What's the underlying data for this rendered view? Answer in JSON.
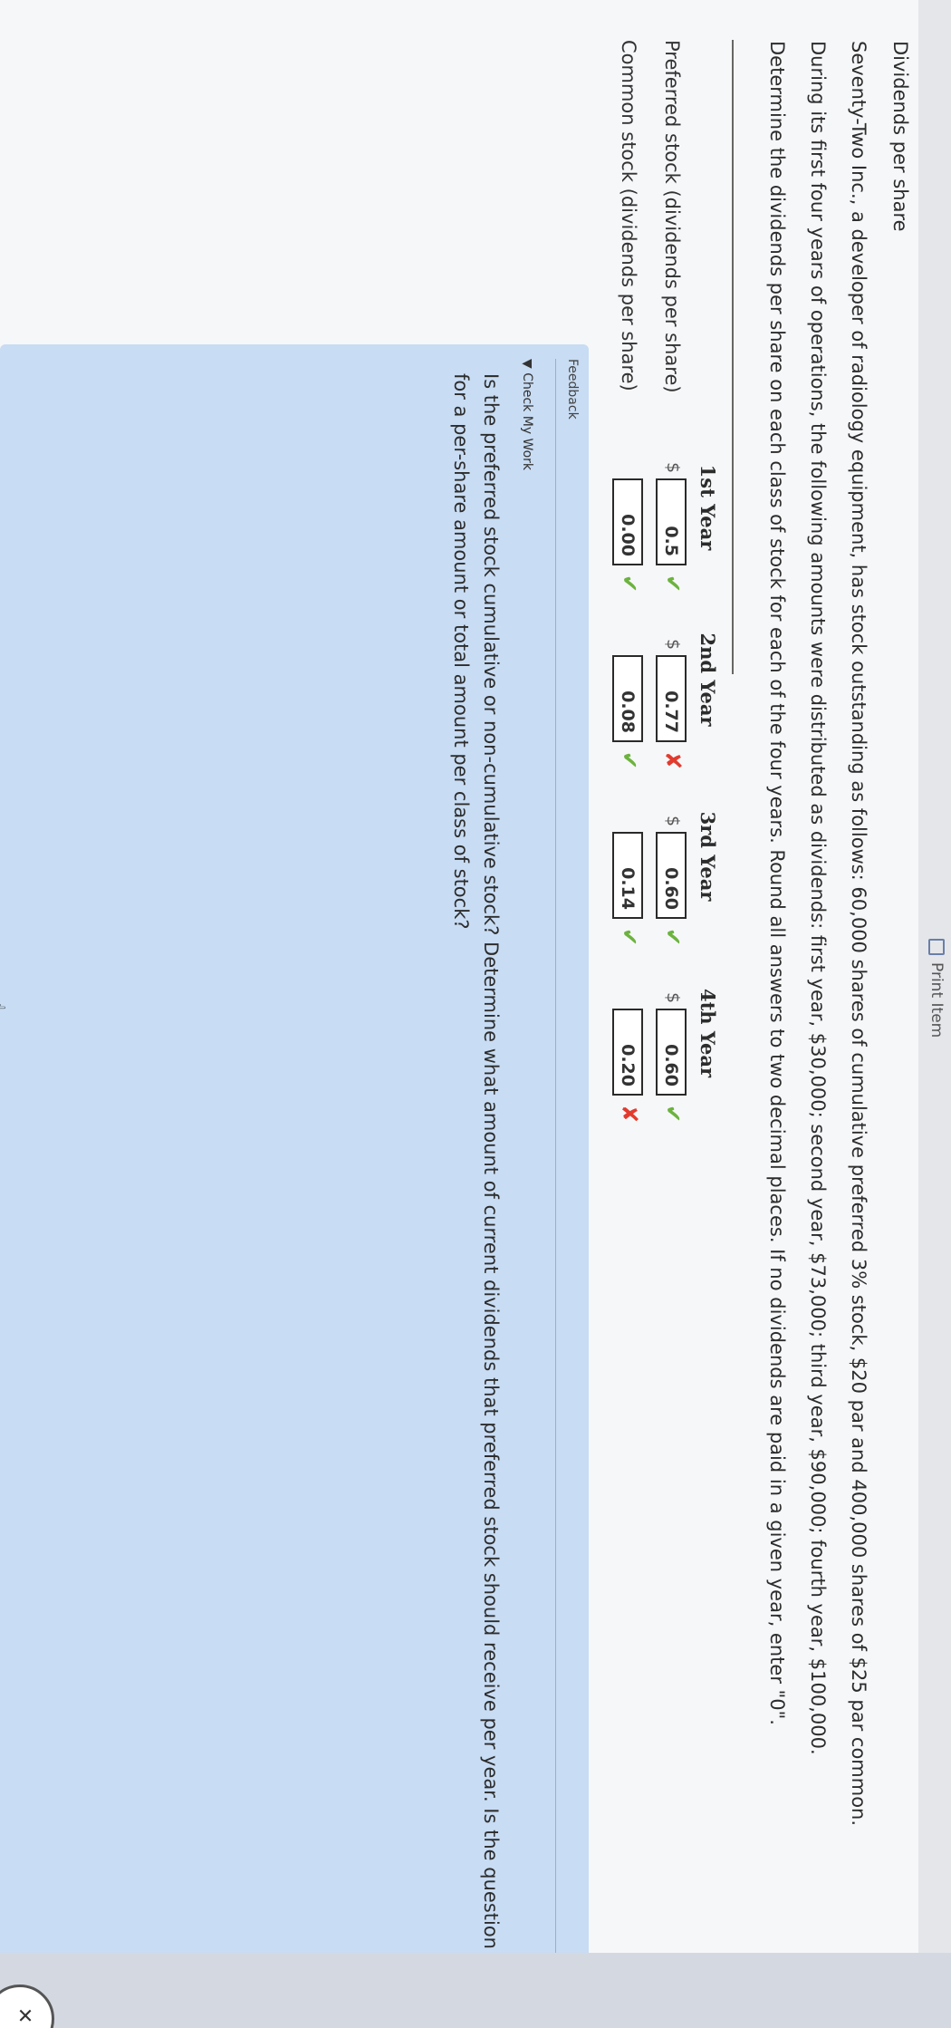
{
  "top_bar": {
    "print_label": "Print Item"
  },
  "title": "Dividends per share",
  "paragraphs": [
    "Seventy-Two Inc., a developer of radiology equipment, has stock outstanding as follows: 60,000 shares of cumulative preferred 3% stock, $20 par and 400,000 shares of $25 par common.",
    "During its first four years of operations, the following amounts were distributed as dividends: first year, $30,000; second year, $73,000; third year, $90,000; fourth year, $100,000.",
    "Determine the dividends per share on each class of stock for each of the four years. Round all answers to two decimal places. If no dividends are paid in a given year, enter \"0\"."
  ],
  "table": {
    "columns": [
      "1st Year",
      "2nd Year",
      "3rd Year",
      "4th Year"
    ],
    "rows": [
      {
        "label": "Preferred stock (dividends per share)",
        "currency": "$",
        "values": [
          "0.5",
          "0.77",
          "0.60",
          "0.60"
        ],
        "marks": [
          "✔",
          "✘",
          "✔",
          "✔"
        ]
      },
      {
        "label": "Common stock (dividends per share)",
        "values": [
          "0.00",
          "0.08",
          "0.14",
          "0.20"
        ],
        "marks": [
          "✔",
          "✔",
          "✔",
          "✘"
        ]
      }
    ]
  },
  "feedback": {
    "label": "Feedback",
    "check_my_work": "▼ Check My Work",
    "text": "Is the preferred stock cumulative or non-cumulative stock? Determine what amount of current dividends that preferred stock should receive per year. Is the question asking for a per-share amount or total amount per class of stock?"
  },
  "colors": {
    "correct": "#6cb33e",
    "incorrect": "#e23b2e",
    "feedback_bg": "#c8dcf3"
  },
  "icons": {
    "hand_cursor": "☝",
    "print": "print-icon"
  }
}
